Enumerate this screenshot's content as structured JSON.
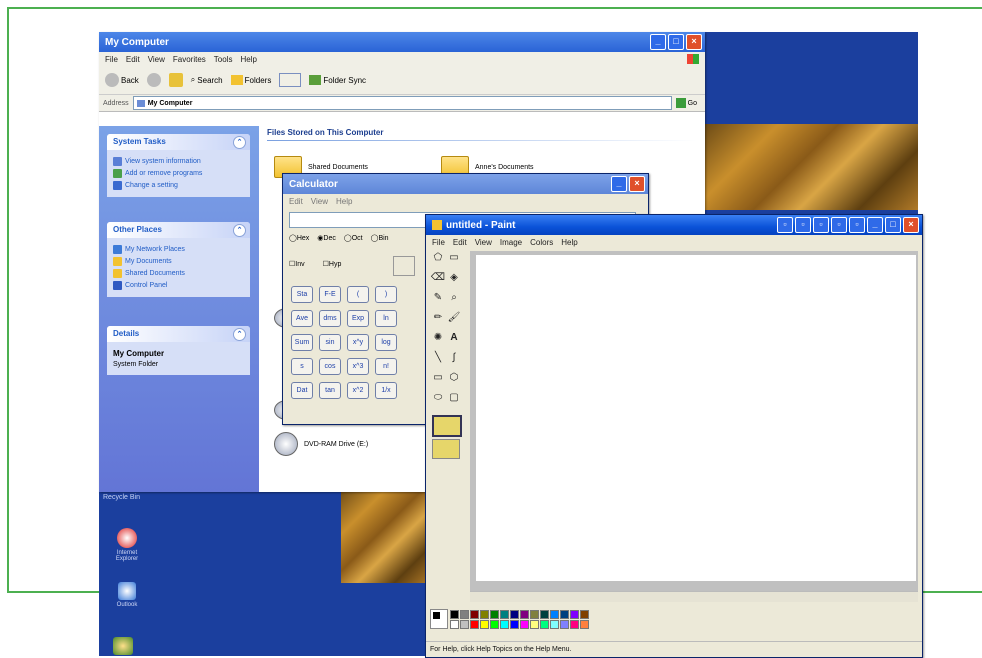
{
  "explorer": {
    "title": "My Computer",
    "menus": [
      "File",
      "Edit",
      "View",
      "Favorites",
      "Tools",
      "Help"
    ],
    "toolbar": {
      "back": "Back",
      "search": "Search",
      "folders": "Folders",
      "folder_sync": "Folder Sync"
    },
    "address_label": "Address",
    "address_value": "My Computer",
    "go_label": "Go",
    "section_title": "Files Stored on This Computer",
    "items": [
      {
        "label": "Shared Documents"
      },
      {
        "label": "Anne's Documents"
      }
    ],
    "drive_label": "DVD-RAM Drive (E:)",
    "system_tasks": {
      "header": "System Tasks",
      "items": [
        "View system information",
        "Add or remove programs",
        "Change a setting"
      ]
    },
    "other_places": {
      "header": "Other Places",
      "items": [
        "My Network Places",
        "My Documents",
        "Shared Documents",
        "Control Panel"
      ]
    },
    "details": {
      "header": "Details",
      "name": "My Computer",
      "type": "System Folder"
    }
  },
  "calculator": {
    "title": "Calculator",
    "menus": [
      "Edit",
      "View",
      "Help"
    ],
    "radios": [
      "Hex",
      "Dec",
      "Oct",
      "Bin"
    ],
    "checks": [
      "Inv",
      "Hyp"
    ],
    "buttons": [
      [
        "Sta",
        "F-E",
        "(",
        ")"
      ],
      [
        "Ave",
        "dms",
        "Exp",
        "ln"
      ],
      [
        "Sum",
        "sin",
        "x^y",
        "log"
      ],
      [
        "s",
        "cos",
        "x^3",
        "n!"
      ],
      [
        "Dat",
        "tan",
        "x^2",
        "1/x"
      ]
    ]
  },
  "paint": {
    "title": "untitled - Paint",
    "menus": [
      "File",
      "Edit",
      "View",
      "Image",
      "Colors",
      "Help"
    ],
    "status": "For Help, click Help Topics on the Help Menu.",
    "palette": [
      "#000000",
      "#808080",
      "#800000",
      "#808000",
      "#008000",
      "#008080",
      "#000080",
      "#800080",
      "#808040",
      "#004040",
      "#0080ff",
      "#004080",
      "#8000ff",
      "#804000",
      "#ffffff",
      "#c0c0c0",
      "#ff0000",
      "#ffff00",
      "#00ff00",
      "#00ffff",
      "#0000ff",
      "#ff00ff",
      "#ffff80",
      "#00ff80",
      "#80ffff",
      "#8080ff",
      "#ff0080",
      "#ff8040"
    ]
  },
  "desktop": {
    "icons": [
      {
        "label": "Internet Explorer"
      },
      {
        "label": "Outlook"
      }
    ],
    "top_label": "Recycle Bin"
  }
}
